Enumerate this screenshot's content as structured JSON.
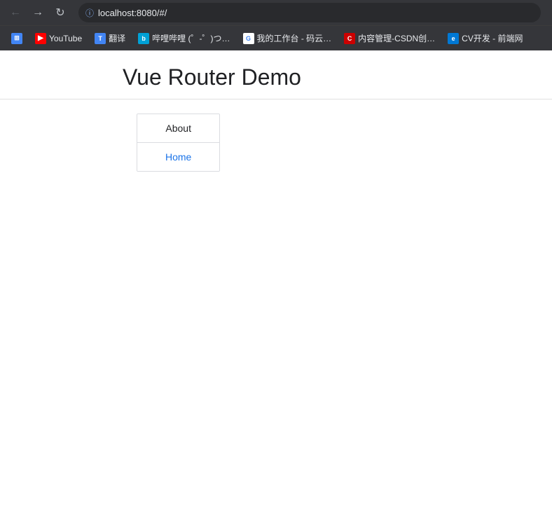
{
  "browser": {
    "address": "localhost:8080/#/",
    "back_btn": "←",
    "forward_btn": "→",
    "reload_btn": "↻",
    "security_icon": "ℹ"
  },
  "bookmarks": [
    {
      "id": "apps",
      "label": "",
      "favicon_type": "apps",
      "favicon_text": "⊞"
    },
    {
      "id": "youtube",
      "label": "YouTube",
      "favicon_type": "youtube",
      "favicon_text": "▶"
    },
    {
      "id": "translate",
      "label": "翻译",
      "favicon_type": "translate",
      "favicon_text": "T"
    },
    {
      "id": "bilibili",
      "label": "哔哩哔哩 (゜-゜)つ…",
      "favicon_type": "bilibili",
      "favicon_text": "b"
    },
    {
      "id": "google",
      "label": "我的工作台 - 码云…",
      "favicon_type": "google",
      "favicon_text": "G"
    },
    {
      "id": "csdn",
      "label": "内容管理-CSDN创…",
      "favicon_type": "csdn",
      "favicon_text": "C"
    },
    {
      "id": "edge",
      "label": "CV开发 - 前端网",
      "favicon_type": "edge",
      "favicon_text": "e"
    }
  ],
  "page": {
    "title": "Vue Router Demo",
    "nav_links": [
      {
        "id": "about",
        "label": "About",
        "class": "about-link"
      },
      {
        "id": "home",
        "label": "Home",
        "class": "home-link"
      }
    ]
  }
}
